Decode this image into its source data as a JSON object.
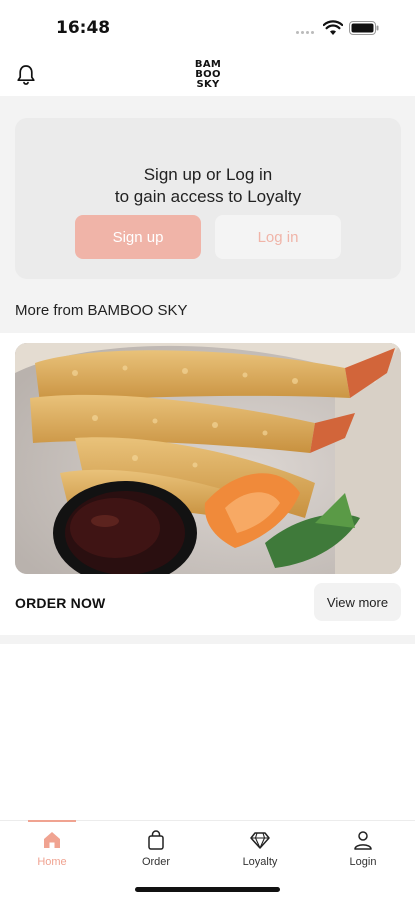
{
  "status_bar": {
    "time": "16:48"
  },
  "header": {
    "brand_lines": [
      "BAM",
      "BOO",
      "SKY"
    ]
  },
  "login_card": {
    "title_line1": "Sign up or Log in",
    "title_line2": "to gain access to Loyalty",
    "signup_label": "Sign up",
    "login_label": "Log in"
  },
  "section": {
    "title": "More from BAMBOO SKY"
  },
  "promo": {
    "action_label": "ORDER NOW",
    "view_more_label": "View more"
  },
  "tabs": [
    {
      "label": "Home",
      "icon": "home-icon",
      "active": true
    },
    {
      "label": "Order",
      "icon": "bag-icon",
      "active": false
    },
    {
      "label": "Loyalty",
      "icon": "diamond-icon",
      "active": false
    },
    {
      "label": "Login",
      "icon": "user-icon",
      "active": false
    }
  ],
  "colors": {
    "accent": "#f0a391",
    "signup_button": "#f0b4a8",
    "card_background": "#ebebeb",
    "content_background": "#f3f3f3"
  }
}
